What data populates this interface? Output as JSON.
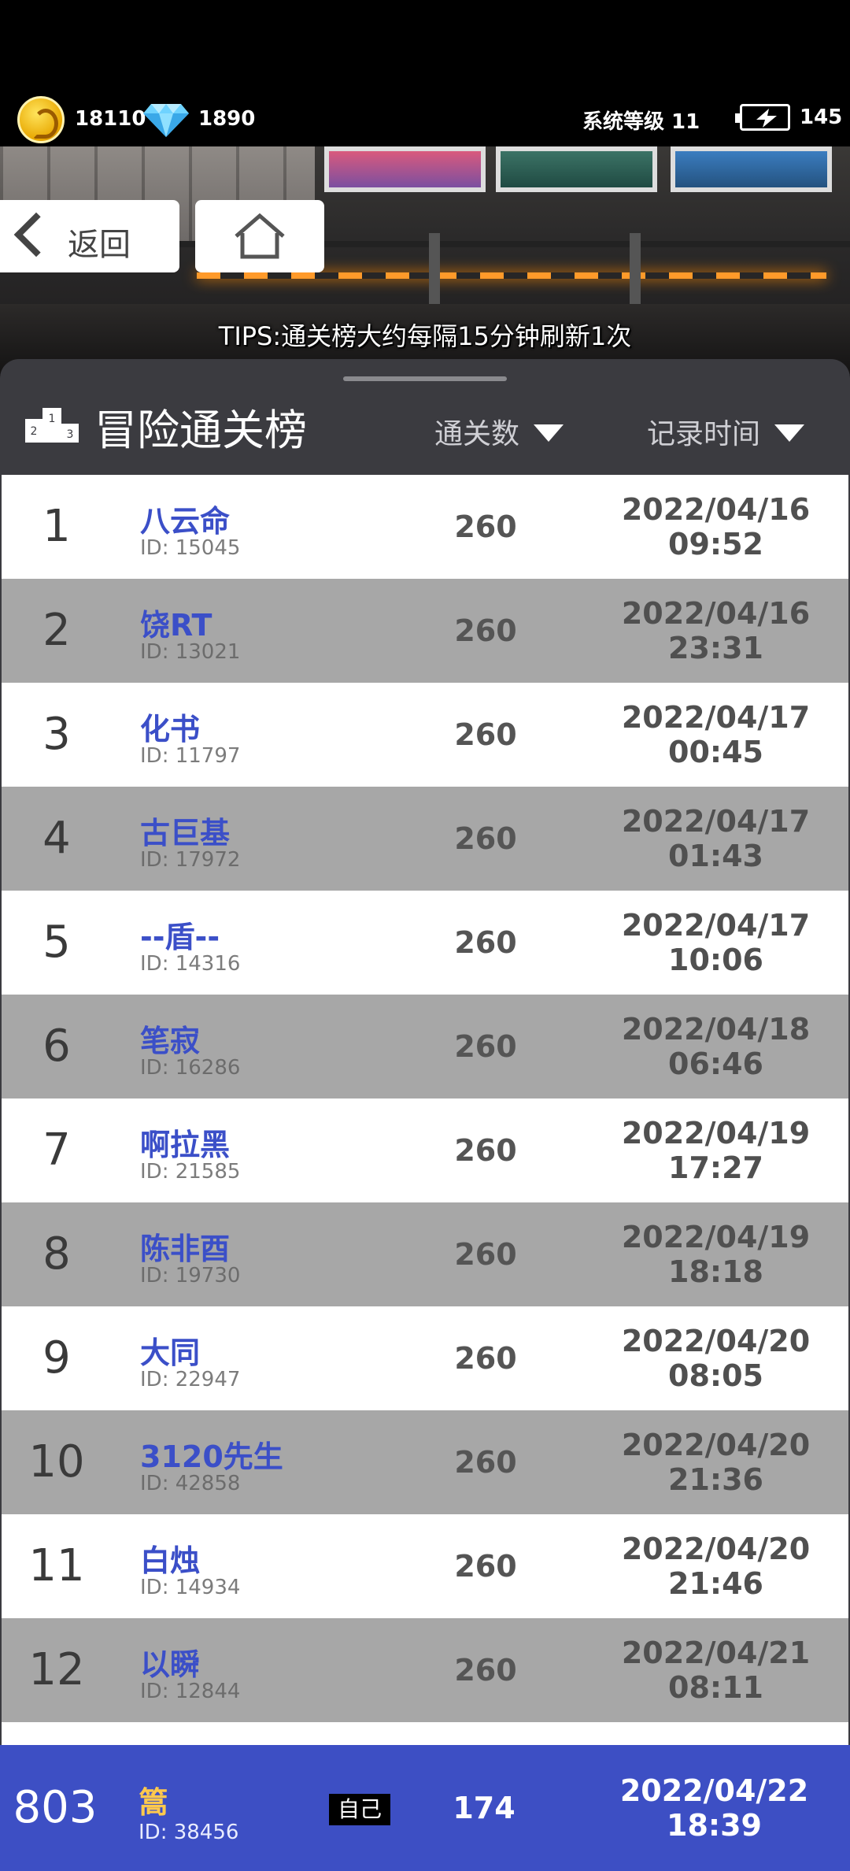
{
  "status": {
    "coins": "18110",
    "diamonds": "1890",
    "system_level": "系统等级 11",
    "energy": "145"
  },
  "nav": {
    "back_label": "返回"
  },
  "tips": "TIPS:通关榜大约每隔15分钟刷新1次",
  "board": {
    "title": "冒险通关榜",
    "sort_clears_label": "通关数",
    "sort_time_label": "记录时间"
  },
  "rows": [
    {
      "rank": "1",
      "name": "八云命",
      "id": "ID: 15045",
      "clears": "260",
      "date": "2022/04/16",
      "time": "09:52"
    },
    {
      "rank": "2",
      "name": "饶RT",
      "id": "ID: 13021",
      "clears": "260",
      "date": "2022/04/16",
      "time": "23:31"
    },
    {
      "rank": "3",
      "name": "化书",
      "id": "ID: 11797",
      "clears": "260",
      "date": "2022/04/17",
      "time": "00:45"
    },
    {
      "rank": "4",
      "name": "古巨基",
      "id": "ID: 17972",
      "clears": "260",
      "date": "2022/04/17",
      "time": "01:43"
    },
    {
      "rank": "5",
      "name": "--盾--",
      "id": "ID: 14316",
      "clears": "260",
      "date": "2022/04/17",
      "time": "10:06"
    },
    {
      "rank": "6",
      "name": "笔寂",
      "id": "ID: 16286",
      "clears": "260",
      "date": "2022/04/18",
      "time": "06:46"
    },
    {
      "rank": "7",
      "name": "啊拉黑",
      "id": "ID: 21585",
      "clears": "260",
      "date": "2022/04/19",
      "time": "17:27"
    },
    {
      "rank": "8",
      "name": "陈非酉",
      "id": "ID: 19730",
      "clears": "260",
      "date": "2022/04/19",
      "time": "18:18"
    },
    {
      "rank": "9",
      "name": "大同",
      "id": "ID: 22947",
      "clears": "260",
      "date": "2022/04/20",
      "time": "08:05"
    },
    {
      "rank": "10",
      "name": "3120先生",
      "id": "ID: 42858",
      "clears": "260",
      "date": "2022/04/20",
      "time": "21:36"
    },
    {
      "rank": "11",
      "name": "白烛",
      "id": "ID: 14934",
      "clears": "260",
      "date": "2022/04/20",
      "time": "21:46"
    },
    {
      "rank": "12",
      "name": "以瞬",
      "id": "ID: 12844",
      "clears": "260",
      "date": "2022/04/21",
      "time": "08:11"
    }
  ],
  "self": {
    "rank": "803",
    "name": "篙",
    "id": "ID: 38456",
    "tag": "自己",
    "clears": "174",
    "date": "2022/04/22",
    "time": "18:39"
  },
  "colors": {
    "name_blue": "#3b4fc8",
    "self_bar": "#3d4fc4",
    "self_name": "#ffc94d",
    "row_alt": "#a7a7a7",
    "panel": "#3b3b40"
  },
  "icons": [
    "coin-icon",
    "diamond-icon",
    "energy-icon",
    "chevron-left-icon",
    "home-icon",
    "podium-icon",
    "sort-down-icon"
  ]
}
